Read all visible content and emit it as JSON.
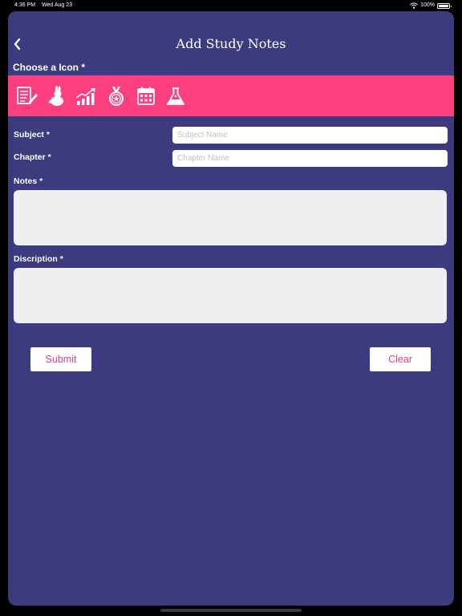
{
  "status_bar": {
    "time": "4:36 PM",
    "date": "Wed Aug 23",
    "battery": "100%",
    "battery_level": 1.0
  },
  "header": {
    "title": "Add Study Notes",
    "back_icon": "chevron-left-icon"
  },
  "icon_picker": {
    "label": "Choose a Icon *",
    "background": "#fd3f7f",
    "icons": [
      "notes-icon",
      "bunny-icon",
      "growth-chart-icon",
      "medal-icon",
      "calendar-icon",
      "flask-icon"
    ]
  },
  "form": {
    "subject_label": "Subject *",
    "subject_placeholder": "Subject Name",
    "subject_value": "",
    "chapter_label": "Chapter *",
    "chapter_placeholder": "Chapter Name",
    "chapter_value": "",
    "notes_label": "Notes *",
    "notes_value": "",
    "description_label": "Discription *",
    "description_value": ""
  },
  "actions": {
    "submit_label": "Submit",
    "clear_label": "Clear",
    "label_color": "#e23c8a"
  },
  "theme": {
    "background": "#3d3b80",
    "accent": "#fd3f7f"
  }
}
